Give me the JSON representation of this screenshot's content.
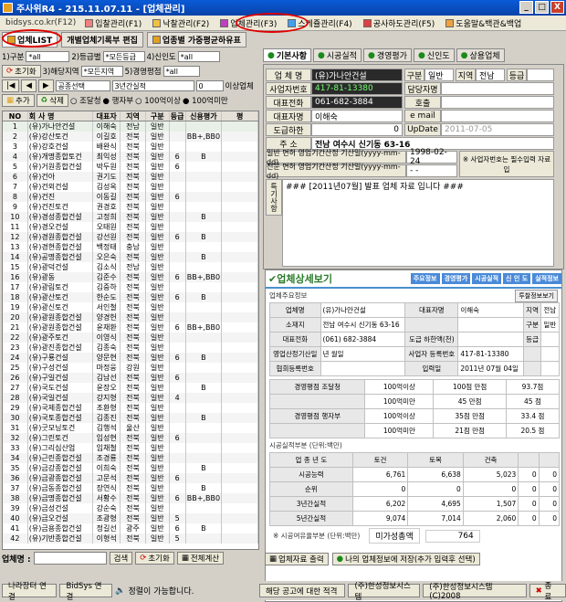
{
  "window": {
    "title": "주사위R4 - 215.11.07.11 - [업체관리]",
    "btn_min": "_",
    "btn_max": "□",
    "btn_close": "X"
  },
  "menu": {
    "site": "bidsys.co.kr(F12)",
    "items": [
      "입찰관리(F1)",
      "낙찰관리(F2)",
      "업체관리(F3)",
      "스케쥴관리(F4)",
      "공사하도관리(F5)",
      "도움말&백관&백업"
    ]
  },
  "subtabs": [
    "업체LIST",
    "개별업체기록부 편집",
    "업종별 가중평균하유표"
  ],
  "filters": {
    "r1_label": "1)구분",
    "r1_val": "*all",
    "r2_label": "2)등급별",
    "r2_val": "*모든등급",
    "r4_label": "4)신인도",
    "r4_val": "*all",
    "r3_label": "3)해당지역",
    "r3_val": "*모든지역",
    "r5_label": "5)경영평점",
    "r5_val": "*all",
    "reset": "초기화",
    "s1": "공종선택",
    "s2": "3년간실적",
    "s3": "0",
    "s4": "이상업체",
    "add": "추가",
    "del": "삭제",
    "o1": "조달청",
    "o2": "행자부",
    "o3": "100억이상",
    "o4": "100억미만"
  },
  "grid": {
    "headers": [
      "NO",
      "회 사 명",
      "대표자",
      "지역",
      "구분",
      "등급",
      "신용평가",
      "평"
    ],
    "rows": [
      [
        "1",
        "(유)가나안건설",
        "이해숙",
        "전남",
        "일반",
        "",
        "",
        ""
      ],
      [
        "2",
        "(유)강산토건",
        "이길호",
        "전북",
        "일반",
        "",
        "BB+,BB0",
        ""
      ],
      [
        "3",
        "(유)강호건설",
        "배완식",
        "전북",
        "일반",
        "",
        "",
        ""
      ],
      [
        "4",
        "(유)개명종합토건",
        "최익성",
        "전북",
        "일반",
        "6",
        "B",
        ""
      ],
      [
        "5",
        "(유)거원종합건설",
        "박두원",
        "전북",
        "일반",
        "6",
        "",
        ""
      ],
      [
        "6",
        "(유)건아",
        "권기도",
        "전북",
        "일반",
        "",
        "",
        ""
      ],
      [
        "7",
        "(유)건외건설",
        "김성옥",
        "전북",
        "일반",
        "",
        "",
        ""
      ],
      [
        "8",
        "(유)건진",
        "이동길",
        "전북",
        "일반",
        "6",
        "",
        ""
      ],
      [
        "9",
        "(유)건진토건",
        "권경호",
        "전북",
        "일반",
        "",
        "",
        ""
      ],
      [
        "10",
        "(유)경성종합건설",
        "고정희",
        "전북",
        "일반",
        "",
        "B",
        ""
      ],
      [
        "11",
        "(유)경오건설",
        "오태원",
        "전북",
        "일반",
        "",
        "",
        ""
      ],
      [
        "12",
        "(유)경원종합건설",
        "강선원",
        "전북",
        "일반",
        "6",
        "B",
        ""
      ],
      [
        "13",
        "(유)경현종합건설",
        "백정태",
        "충남",
        "일반",
        "",
        "",
        ""
      ],
      [
        "14",
        "(유)공명종합건설",
        "오은숙",
        "전북",
        "일반",
        "",
        "B",
        ""
      ],
      [
        "15",
        "(유)광덕건설",
        "김소식",
        "전남",
        "일반",
        "",
        "",
        ""
      ],
      [
        "16",
        "(유)광동",
        "김준수",
        "전북",
        "일반",
        "6",
        "BB+,BB0",
        ""
      ],
      [
        "17",
        "(유)광림토건",
        "김중하",
        "전북",
        "일반",
        "",
        "",
        ""
      ],
      [
        "18",
        "(유)광산토건",
        "한순도",
        "전북",
        "일반",
        "6",
        "B",
        ""
      ],
      [
        "19",
        "(유)광신토건",
        "서인철",
        "전북",
        "일반",
        "",
        "",
        ""
      ],
      [
        "20",
        "(유)광원종합건설",
        "양경헌",
        "전북",
        "일반",
        "",
        "",
        ""
      ],
      [
        "21",
        "(유)광원종합건설",
        "윤재환",
        "전북",
        "일반",
        "6",
        "BB+,BB0",
        ""
      ],
      [
        "22",
        "(유)광주토건",
        "이영식",
        "전북",
        "일반",
        "",
        "",
        ""
      ],
      [
        "23",
        "(유)광진종합건설",
        "김종숙",
        "전북",
        "일반",
        "",
        "",
        ""
      ],
      [
        "24",
        "(유)구룡건설",
        "양문현",
        "전북",
        "일반",
        "6",
        "B",
        ""
      ],
      [
        "25",
        "(유)구성건설",
        "마정웅",
        "강원",
        "일반",
        "",
        "",
        ""
      ],
      [
        "26",
        "(유)구일건설",
        "김남선",
        "전북",
        "일반",
        "6",
        "",
        ""
      ],
      [
        "27",
        "(유)국도건설",
        "윤장오",
        "전북",
        "일반",
        "",
        "B",
        ""
      ],
      [
        "28",
        "(유)국일건설",
        "강지형",
        "전북",
        "일반",
        "4",
        "",
        ""
      ],
      [
        "29",
        "(유)국제종합건설",
        "조환형",
        "전북",
        "일반",
        "",
        "",
        ""
      ],
      [
        "30",
        "(유)국토종합건설",
        "김종진",
        "전북",
        "일반",
        "",
        "B",
        ""
      ],
      [
        "31",
        "(유)굿모닝토건",
        "김행석",
        "울산",
        "일반",
        "",
        "",
        ""
      ],
      [
        "32",
        "(유)그린토건",
        "임성현",
        "전북",
        "일반",
        "6",
        "",
        ""
      ],
      [
        "33",
        "(유)그리심산업",
        "임채철",
        "전북",
        "일반",
        "",
        "",
        ""
      ],
      [
        "34",
        "(유)근린종합건설",
        "조경룡",
        "전북",
        "일반",
        "",
        "",
        ""
      ],
      [
        "35",
        "(유)금강종합건설",
        "이희숙",
        "전북",
        "일반",
        "",
        "B",
        ""
      ],
      [
        "36",
        "(유)금광종합건설",
        "고문석",
        "전북",
        "일반",
        "6",
        "",
        ""
      ],
      [
        "37",
        "(유)금동종합건설",
        "장연식",
        "전북",
        "일반",
        "",
        "B",
        ""
      ],
      [
        "38",
        "(유)금명종합건설",
        "서황수",
        "전북",
        "일반",
        "6",
        "BB+,BB0",
        ""
      ],
      [
        "39",
        "(유)금성건설",
        "강순숙",
        "전북",
        "일반",
        "",
        "",
        ""
      ],
      [
        "40",
        "(유)금오건설",
        "조광형",
        "전북",
        "일반",
        "5",
        "",
        ""
      ],
      [
        "41",
        "(유)금용종합건설",
        "정길선",
        "광주",
        "일반",
        "6",
        "B",
        ""
      ],
      [
        "42",
        "(유)기반종합건설",
        "이형석",
        "전북",
        "일반",
        "5",
        "",
        ""
      ]
    ]
  },
  "bottomL": {
    "label": "업체명 :",
    "search": "검색",
    "reset": "초기화",
    "calc": "전체계산"
  },
  "rtabs": [
    "기본사항",
    "시공실적",
    "경영평가",
    "신인도",
    "상용업체"
  ],
  "form": {
    "l_name": "업 체 명",
    "v_name": "(유)가나안건설",
    "l_gubun": "구분",
    "v_gubun": "일반",
    "l_region": "지역",
    "v_region": "전남",
    "l_grade": "등급",
    "l_biz": "사업자번호",
    "v_biz": "417-81-13380",
    "l_mgr": "담당자명",
    "l_tel": "대표전화",
    "v_tel": "061-682-3884",
    "l_ho": "호출",
    "l_rep": "대표자명",
    "v_rep": "이해숙",
    "l_email": "e mail",
    "l_reg": "도급하한",
    "v_reg": "0",
    "l_date": "UpDate",
    "v_date": "2011-07-05",
    "l_addr": "주 소",
    "v_addr": "전남 여수시 신기동 63-16",
    "l_lic1": "일반 면허 영업기간산정 기산일(yyyy-mm-dd)",
    "v_lic1": "1998-02-24",
    "l_lic2": "전문 면허 영업기간산정 기산일(yyyy-mm-dd)",
    "v_lic2": "- -",
    "note_btn": "※ 사업자번호는 필수입력 자료 입",
    "l_spec": "특기사항",
    "v_spec": "### [2011년07월] 발표 업체 자료 입니다 ###"
  },
  "detail": {
    "title": "업체상세보기",
    "tabs": [
      "주요정보",
      "경영평가",
      "시공실적",
      "신 인 도",
      "실적정보"
    ],
    "sec1": "업체주요정보",
    "btn": "투찰정보보기",
    "rows": [
      [
        "업체명",
        "(유)가나안건설",
        "대표자명",
        "이해숙",
        "지역",
        "전남"
      ],
      [
        "소재지",
        "전남 여수시 신기동 63-16",
        "",
        "",
        "구분",
        "일반"
      ],
      [
        "대표전화",
        "(061) 682-3884",
        "도급 하한액(천)",
        "",
        "등급",
        ""
      ],
      [
        "영업산정기산일",
        "년 월일",
        "사업자 등록번호",
        "417-81-13380",
        "",
        ""
      ],
      [
        "협회등록번호",
        "",
        "입력일",
        "2011년 07월 04일",
        "",
        ""
      ]
    ],
    "mg": [
      [
        "경영평점 조달청",
        "100억이상",
        "100점 만점",
        "93.7점"
      ],
      [
        "",
        "100억미만",
        "45 만점",
        "45 점"
      ],
      [
        "경영평점 행자부",
        "100억이상",
        "35점 만점",
        "33.4 점"
      ],
      [
        "",
        "100억미만",
        "21점 만점",
        "20.5 점"
      ]
    ],
    "sec2": "시공실적부분 (단위:백만)",
    "sh": [
      "업 종 년 도",
      "토건",
      "토목",
      "건축",
      "",
      ""
    ],
    "sr": [
      [
        "시공능력",
        "6,761",
        "6,638",
        "5,023",
        "0",
        "0"
      ],
      [
        "순위",
        "0",
        "0",
        "0",
        "0",
        "0"
      ],
      [
        "3년간실적",
        "6,202",
        "4,695",
        "1,507",
        "0",
        "0"
      ],
      [
        "5년간실적",
        "9,074",
        "7,014",
        "2,060",
        "0",
        "0"
      ]
    ],
    "sec3": "※ 시공여유율부분 (단위:백만)",
    "yu_label": "미가성총액",
    "yu_val": "764",
    "print": "업체자료 출력",
    "save": "나의 업체정보에 저장(추가 입력후 선택)"
  },
  "footer": {
    "b1": "나라장터 연결",
    "b2": "BidSys 연결",
    "msg": "정렬이 가능합니다.",
    "ticker": "해당 공고에 대한 적격",
    "co1": "(주)한성정보시스템",
    "co2": "(주)한성정보시스템 (C)2008",
    "end": "종 료"
  }
}
